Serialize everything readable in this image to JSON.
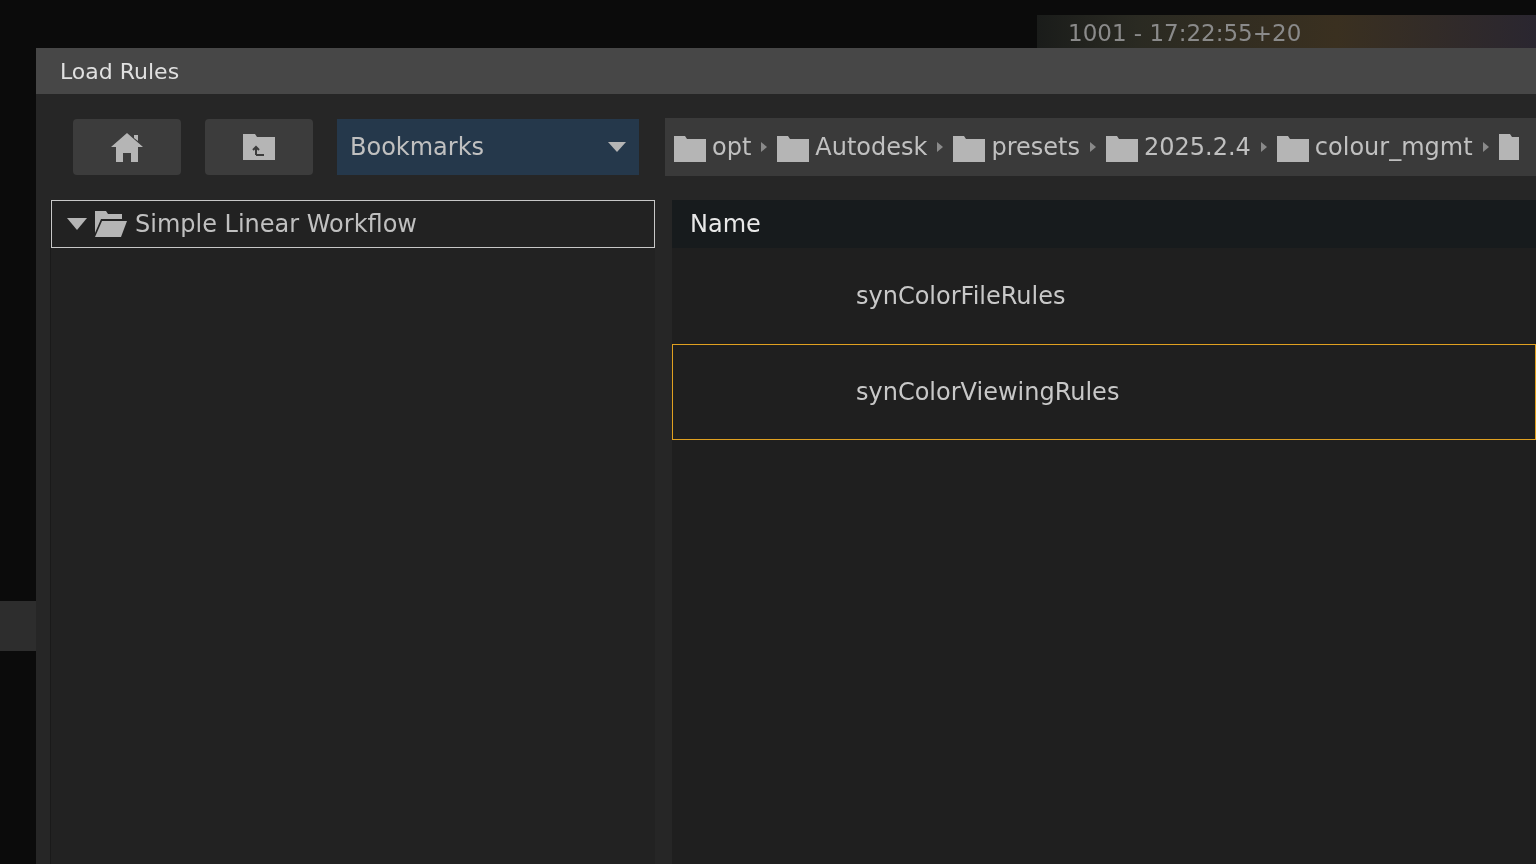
{
  "background": {
    "timecode": "1001 - 17:22:55+20"
  },
  "window": {
    "title": "Load Rules"
  },
  "toolbar": {
    "bookmarks": {
      "value": "Bookmarks"
    }
  },
  "breadcrumbs": [
    {
      "label": "opt"
    },
    {
      "label": "Autodesk"
    },
    {
      "label": "presets"
    },
    {
      "label": "2025.2.4"
    },
    {
      "label": "colour_mgmt"
    }
  ],
  "tree": [
    {
      "label": "Simple Linear Workflow",
      "expanded": true
    }
  ],
  "file_list": {
    "columns": [
      "Name"
    ],
    "rows": [
      {
        "name": "synColorFileRules",
        "selected": false
      },
      {
        "name": "synColorViewingRules",
        "selected": true
      }
    ]
  }
}
